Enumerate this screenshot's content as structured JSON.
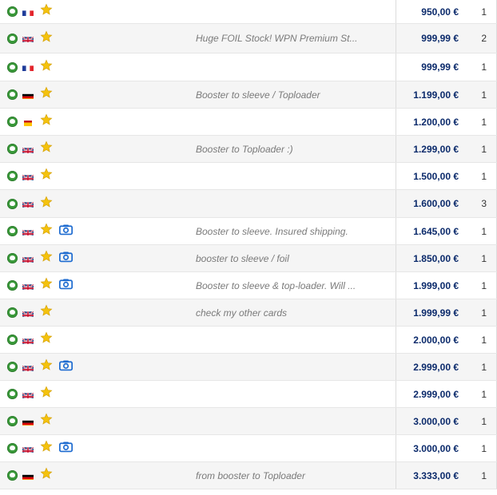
{
  "colors": {
    "price": "#0b2a6b",
    "comment": "#7a7a7a",
    "condition_green": "#3a9a3a",
    "star": "#f4c20d",
    "camera": "#1d6bd0",
    "row_alt_bg": "#f5f5f5"
  },
  "listings": [
    {
      "flag": "fr",
      "star": true,
      "photo": false,
      "comment": "",
      "price": "950,00 €",
      "qty": "1"
    },
    {
      "flag": "gb",
      "star": true,
      "photo": false,
      "comment": "Huge FOIL Stock! WPN Premium St...",
      "price": "999,99 €",
      "qty": "2"
    },
    {
      "flag": "fr",
      "star": true,
      "photo": false,
      "comment": "",
      "price": "999,99 €",
      "qty": "1"
    },
    {
      "flag": "de",
      "star": true,
      "photo": false,
      "comment": "Booster to sleeve / Toploader",
      "price": "1.199,00 €",
      "qty": "1"
    },
    {
      "flag": "es",
      "star": true,
      "photo": false,
      "comment": "",
      "price": "1.200,00 €",
      "qty": "1"
    },
    {
      "flag": "gb",
      "star": true,
      "photo": false,
      "comment": "Booster to Toploader :)",
      "price": "1.299,00 €",
      "qty": "1"
    },
    {
      "flag": "gb",
      "star": true,
      "photo": false,
      "comment": "",
      "price": "1.500,00 €",
      "qty": "1"
    },
    {
      "flag": "gb",
      "star": true,
      "photo": false,
      "comment": "",
      "price": "1.600,00 €",
      "qty": "3"
    },
    {
      "flag": "gb",
      "star": true,
      "photo": true,
      "comment": "Booster to sleeve. Insured shipping.",
      "price": "1.645,00 €",
      "qty": "1"
    },
    {
      "flag": "gb",
      "star": true,
      "photo": true,
      "comment": "booster to sleeve / foil",
      "price": "1.850,00 €",
      "qty": "1"
    },
    {
      "flag": "gb",
      "star": true,
      "photo": true,
      "comment": "Booster to sleeve & top-loader. Will ...",
      "price": "1.999,00 €",
      "qty": "1"
    },
    {
      "flag": "gb",
      "star": true,
      "photo": false,
      "comment": "check my other cards",
      "price": "1.999,99 €",
      "qty": "1"
    },
    {
      "flag": "gb",
      "star": true,
      "photo": false,
      "comment": "",
      "price": "2.000,00 €",
      "qty": "1"
    },
    {
      "flag": "gb",
      "star": true,
      "photo": true,
      "comment": "",
      "price": "2.999,00 €",
      "qty": "1"
    },
    {
      "flag": "gb",
      "star": true,
      "photo": false,
      "comment": "",
      "price": "2.999,00 €",
      "qty": "1"
    },
    {
      "flag": "de",
      "star": true,
      "photo": false,
      "comment": "",
      "price": "3.000,00 €",
      "qty": "1"
    },
    {
      "flag": "gb",
      "star": true,
      "photo": true,
      "comment": "",
      "price": "3.000,00 €",
      "qty": "1"
    },
    {
      "flag": "de",
      "star": true,
      "photo": false,
      "comment": "from booster to Toploader",
      "price": "3.333,00 €",
      "qty": "1"
    }
  ]
}
